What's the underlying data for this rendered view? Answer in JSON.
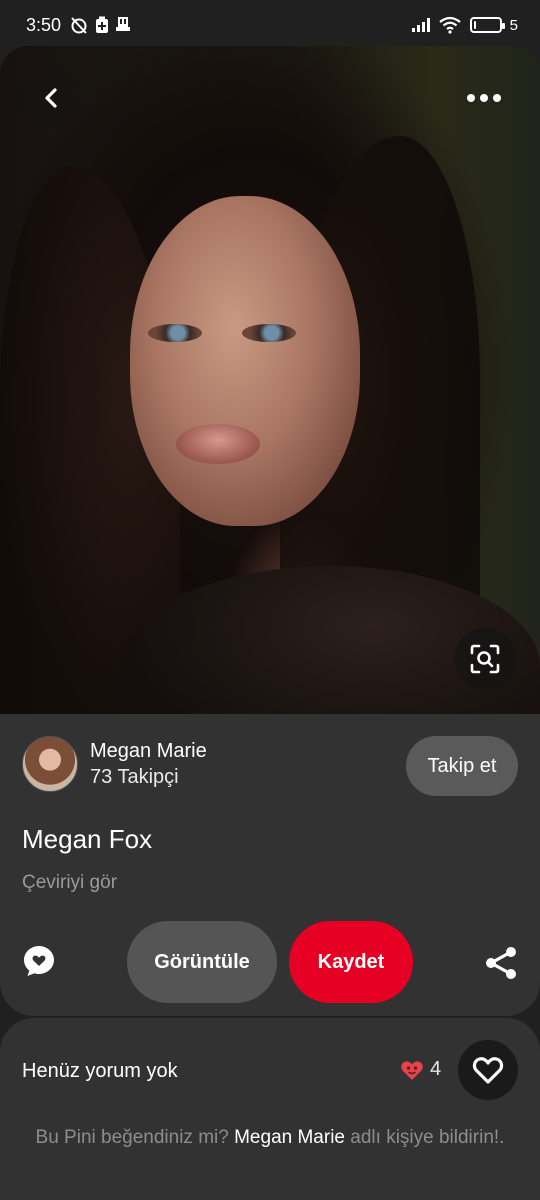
{
  "status_bar": {
    "time": "3:50",
    "battery_text": "5",
    "battery_level": 0.05,
    "icons": [
      "alarm-off-icon",
      "battery-saver-icon",
      "sd-card-icon",
      "signal-icon",
      "wifi-icon",
      "battery-icon"
    ]
  },
  "pin": {
    "image_alt": "Megan Fox",
    "icons": {
      "back": "back-arrow-icon",
      "more": "more-dots-icon",
      "visual_search": "lens-search-icon"
    }
  },
  "author": {
    "name": "Megan Marie",
    "followers": "73 Takipçi",
    "follow_label": "Takip et"
  },
  "details": {
    "title": "Megan Fox",
    "translate_label": "Çeviriyi gör"
  },
  "actions": {
    "view_label": "Görüntüle",
    "save_label": "Kaydet",
    "save_color": "#e60023",
    "icons": {
      "comment": "comment-bubble-icon",
      "share": "share-icon"
    }
  },
  "comments": {
    "empty_label": "Henüz yorum yok",
    "reaction_count": "4",
    "reaction_icon": "heart-eyes-icon",
    "like_icon": "heart-outline-icon",
    "prompt_before": "Bu Pini beğendiniz mi?",
    "prompt_name": "Megan Marie",
    "prompt_after": "adlı kişiye bildirin!."
  }
}
